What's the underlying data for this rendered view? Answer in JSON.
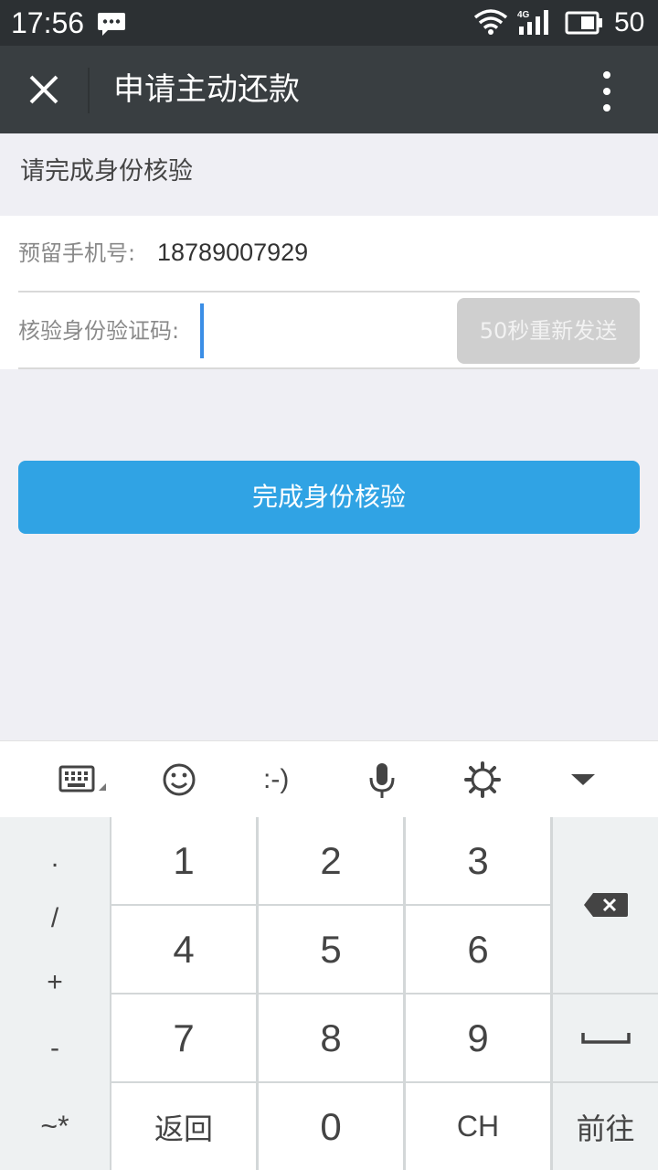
{
  "status_bar": {
    "time": "17:56",
    "battery": "50",
    "network": "4G"
  },
  "header": {
    "title": "申请主动还款"
  },
  "section": {
    "title": "请完成身份核验"
  },
  "form": {
    "phone_label": "预留手机号:",
    "phone_value": "18789007929",
    "code_label": "核验身份验证码:",
    "code_value": "",
    "resend_label": "50秒重新发送"
  },
  "primary_button": {
    "label": "完成身份核验"
  },
  "keyboard": {
    "toolbar": {
      "emoticon_label": ":-)"
    },
    "symbols": [
      ".",
      "/",
      "+",
      "-",
      "~*"
    ],
    "digits": [
      "1",
      "2",
      "3",
      "4",
      "5",
      "6",
      "7",
      "8",
      "9",
      "0"
    ],
    "back_label": "返回",
    "ch_label": "CH",
    "go_label": "前往"
  },
  "colors": {
    "status_bar": "#2c3033",
    "title_bar": "#393e41",
    "primary": "#30a3e4",
    "disabled_button": "#cfcfcf",
    "caret": "#3b8ee6",
    "page_bg": "#efeff4"
  }
}
